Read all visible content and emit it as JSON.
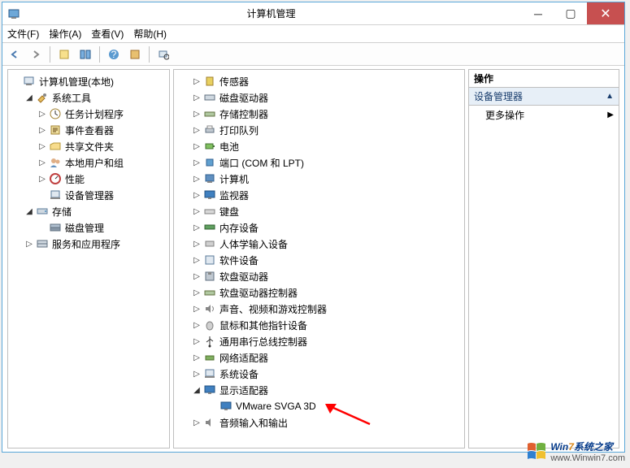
{
  "window": {
    "title": "计算机管理"
  },
  "menu": {
    "file": "文件(F)",
    "action": "操作(A)",
    "view": "查看(V)",
    "help": "帮助(H)"
  },
  "left_tree": {
    "root": "计算机管理(本地)",
    "sys_tools": "系统工具",
    "task_sched": "任务计划程序",
    "event_viewer": "事件查看器",
    "shared": "共享文件夹",
    "users": "本地用户和组",
    "perf": "性能",
    "devmgr": "设备管理器",
    "storage": "存储",
    "diskmgmt": "磁盘管理",
    "services": "服务和应用程序"
  },
  "mid_tree": {
    "sensors": "传感器",
    "disk_drives": "磁盘驱动器",
    "storage_ctrl": "存储控制器",
    "print_queue": "打印队列",
    "battery": "电池",
    "ports": "端口 (COM 和 LPT)",
    "computer": "计算机",
    "monitor": "监视器",
    "keyboard": "键盘",
    "memory": "内存设备",
    "hid": "人体学输入设备",
    "software_dev": "软件设备",
    "floppy_drives": "软盘驱动器",
    "floppy_ctrl": "软盘驱动器控制器",
    "sound": "声音、视频和游戏控制器",
    "mouse": "鼠标和其他指针设备",
    "usb": "通用串行总线控制器",
    "network": "网络适配器",
    "system_dev": "系统设备",
    "display": "显示适配器",
    "display_item": "VMware SVGA 3D",
    "audio_io": "音频输入和输出"
  },
  "actions": {
    "header": "操作",
    "section": "设备管理器",
    "more": "更多操作"
  },
  "watermark": {
    "brand1": "Win",
    "brand2": "7",
    "brand3": "系统之家",
    "url": "www.Winwin7.com"
  }
}
